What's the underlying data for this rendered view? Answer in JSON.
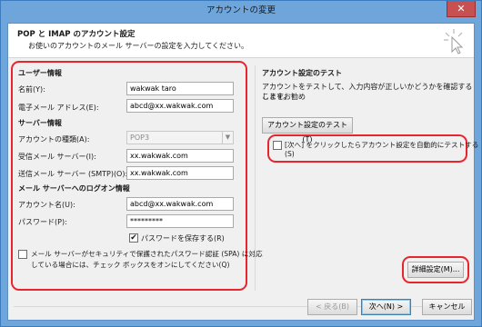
{
  "window": {
    "title": "アカウントの変更",
    "close_glyph": "✕"
  },
  "header": {
    "title": "POP と IMAP のアカウント設定",
    "subtitle": "お使いのアカウントのメール サーバーの設定を入力してください。"
  },
  "user_info": {
    "section_title": "ユーザー情報",
    "name_label": "名前(Y):",
    "name_value": "wakwak taro",
    "email_label": "電子メール アドレス(E):",
    "email_value": "abcd@xx.wakwak.com"
  },
  "server_info": {
    "section_title": "サーバー情報",
    "account_type_label": "アカウントの種類(A):",
    "account_type_value": "POP3",
    "incoming_label": "受信メール サーバー(I):",
    "incoming_value": "xx.wakwak.com",
    "outgoing_label": "送信メール サーバー (SMTP)(O):",
    "outgoing_value": "xx.wakwak.com"
  },
  "logon_info": {
    "section_title": "メール サーバーへのログオン情報",
    "account_name_label": "アカウント名(U):",
    "account_name_value": "abcd@xx.wakwak.com",
    "password_label": "パスワード(P):",
    "password_value": "*********",
    "save_password_label": "パスワードを保存する(R)",
    "save_password_checked": "✔",
    "spa_label_line1": "メール サーバーがセキュリティで保護されたパスワード認証 (SPA) に対応",
    "spa_label_line2": "している場合には、チェック ボックスをオンにしてください(Q)"
  },
  "test": {
    "section_title": "アカウント設定のテスト",
    "description_line1": "アカウントをテストして、入力内容が正しいかどうかを確認することをお勧め",
    "description_line2": "します。",
    "test_button": "アカウント設定のテスト(T)",
    "auto_test_line1": "[次へ] をクリックしたらアカウント設定を自動的にテストする",
    "auto_test_line2": "(S)"
  },
  "buttons": {
    "more_settings": "詳細設定(M)...",
    "back": "< 戻る(B)",
    "next": "次へ(N) >",
    "cancel": "キャンセル"
  },
  "colors": {
    "highlight": "#e8242d",
    "titlebar": "#6ea6dc",
    "close": "#c75050"
  }
}
